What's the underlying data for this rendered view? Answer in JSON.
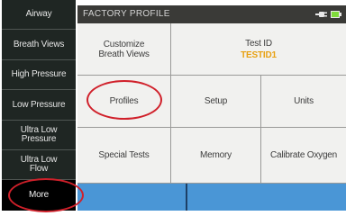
{
  "sidebar": {
    "items": [
      {
        "label": "Airway"
      },
      {
        "label": "Breath Views"
      },
      {
        "label": "High Pressure"
      },
      {
        "label": "Low Pressure"
      },
      {
        "label": "Ultra Low\nPressure"
      },
      {
        "label": "Ultra Low\nFlow"
      },
      {
        "label": "More"
      }
    ]
  },
  "header": {
    "title": "FACTORY PROFILE",
    "icons": [
      "plug-icon",
      "battery-icon"
    ],
    "battery_color": "#7fdc3a"
  },
  "grid": {
    "customize": "Customize\nBreath Views",
    "test_id_label": "Test ID",
    "test_id_value": "TESTID1",
    "profiles": "Profiles",
    "setup": "Setup",
    "units": "Units",
    "special_tests": "Special Tests",
    "memory": "Memory",
    "calibrate_oxygen": "Calibrate Oxygen"
  },
  "colors": {
    "sidebar_bg": "#1f2623",
    "header_bg": "#3a3a37",
    "cell_bg": "#f1f1ef",
    "bottom_bar": "#4a96d6",
    "highlight_ring": "#d0202a",
    "test_id_value": "#e8a112"
  }
}
